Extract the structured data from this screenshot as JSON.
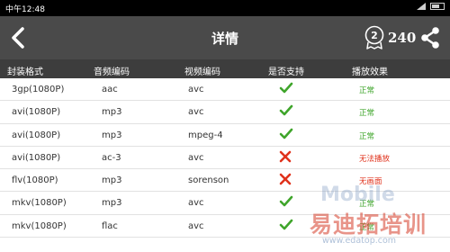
{
  "status_bar": {
    "time": "中午12:48"
  },
  "header": {
    "title": "详情",
    "badge_count": "240"
  },
  "table": {
    "columns": [
      "封装格式",
      "音频编码",
      "视频编码",
      "是否支持",
      "播放效果"
    ],
    "rows": [
      {
        "container": "3gp(1080P)",
        "audio": "aac",
        "video": "avc",
        "supported": true,
        "effect": "正常"
      },
      {
        "container": "avi(1080P)",
        "audio": "mp3",
        "video": "avc",
        "supported": true,
        "effect": "正常"
      },
      {
        "container": "avi(1080P)",
        "audio": "mp3",
        "video": "mpeg-4",
        "supported": true,
        "effect": "正常"
      },
      {
        "container": "avi(1080P)",
        "audio": "ac-3",
        "video": "avc",
        "supported": false,
        "effect": "无法播放"
      },
      {
        "container": "flv(1080P)",
        "audio": "mp3",
        "video": "sorenson",
        "supported": false,
        "effect": "无画面"
      },
      {
        "container": "mkv(1080P)",
        "audio": "mp3",
        "video": "avc",
        "supported": true,
        "effect": "正常"
      },
      {
        "container": "mkv(1080P)",
        "audio": "flac",
        "video": "avc",
        "supported": true,
        "effect": "正常"
      }
    ]
  },
  "watermark": {
    "mobile_text": "Mobile",
    "brand_text": "易迪拓培训",
    "url": "www.edatop.com"
  },
  "colors": {
    "nav_bg": "#4a4a4a",
    "header_bg": "#3d3d3d",
    "ok": "#3fa52b",
    "bad": "#e0321c"
  }
}
